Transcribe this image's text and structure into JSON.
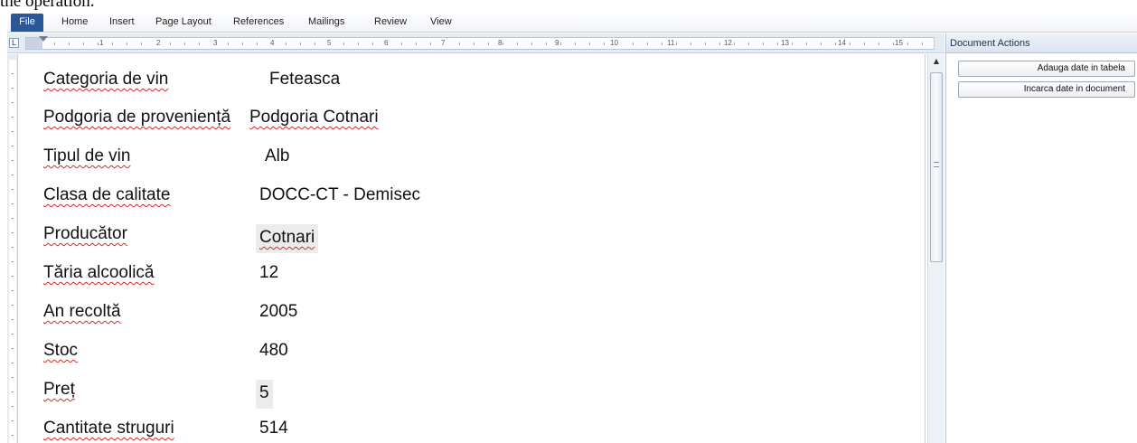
{
  "caption": "the operation.",
  "ribbon": {
    "tabs": [
      "File",
      "Home",
      "Insert",
      "Page Layout",
      "References",
      "Mailings",
      "Review",
      "View"
    ]
  },
  "ruler": {
    "tab_selector": "L",
    "numbers": [
      "1",
      "2",
      "3",
      "4",
      "5",
      "6",
      "7",
      "8",
      "9",
      "10",
      "11",
      "12",
      "13",
      "14",
      "15"
    ]
  },
  "document": {
    "rows": [
      {
        "label": "Categoria de vin",
        "value": "Feteasca"
      },
      {
        "label": "Podgoria de proveniență",
        "value": "Podgoria Cotnari"
      },
      {
        "label": "Tipul de vin",
        "value": "Alb"
      },
      {
        "label": "Clasa de calitate",
        "value": "DOCC-CT - Demisec"
      },
      {
        "label": "Producător",
        "value": "Cotnari"
      },
      {
        "label": "Tăria alcoolică",
        "value": "12"
      },
      {
        "label": "An recoltă",
        "value": "2005"
      },
      {
        "label": "Stoc",
        "value": "480"
      },
      {
        "label": "Preț",
        "value": "5"
      },
      {
        "label": "Cantitate struguri",
        "value": "514"
      }
    ]
  },
  "pane": {
    "title": "Document Actions",
    "buttons": [
      "Adauga date in tabela",
      "Incarca date in document"
    ]
  },
  "colors": {
    "file_tab": "#2b5797",
    "spell_underline": "#d32b2b",
    "field_shading": "#ececec"
  }
}
